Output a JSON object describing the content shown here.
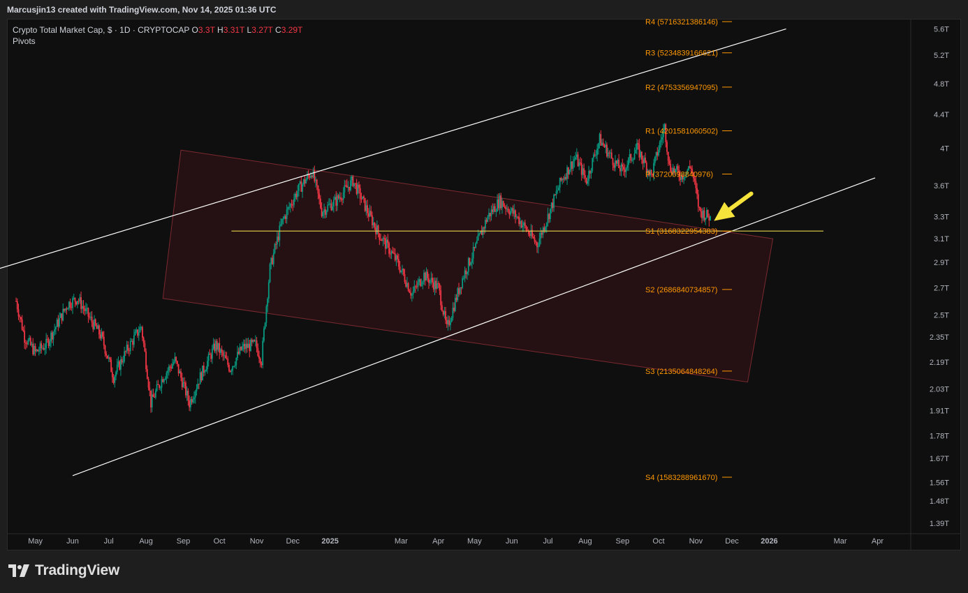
{
  "header": {
    "title": "Marcusjin13 created with TradingView.com, Nov 14, 2025 01:36 UTC"
  },
  "legend": {
    "symbol": "Crypto Total Market Cap, $ · 1D · CRYPTOCAP",
    "o_label": "O",
    "o_value": "3.3T",
    "h_label": "H",
    "h_value": "3.31T",
    "l_label": "L",
    "l_value": "3.27T",
    "c_label": "C",
    "c_value": "3.29T",
    "indicator": "Pivots"
  },
  "footer": {
    "brand": "TradingView"
  },
  "colors": {
    "up": "#089981",
    "down": "#f23645",
    "pivot": "#ff9800",
    "channel": "#ffffff",
    "support": "#e6d44a",
    "box_fill": "#2a1214",
    "box_stroke": "#7a2a30",
    "arrow": "#f5e33c"
  },
  "chart_data": {
    "type": "candlestick",
    "y_scale": "log",
    "ylim": [
      1.35,
      5.75
    ],
    "y_ticks": [
      "5.6T",
      "5.2T",
      "4.8T",
      "4.4T",
      "4T",
      "3.6T",
      "3.3T",
      "3.1T",
      "2.9T",
      "2.7T",
      "2.5T",
      "2.35T",
      "2.19T",
      "2.03T",
      "1.91T",
      "1.78T",
      "1.67T",
      "1.56T",
      "1.48T",
      "1.39T"
    ],
    "y_tick_values": [
      5.6,
      5.2,
      4.8,
      4.4,
      4.0,
      3.6,
      3.3,
      3.1,
      2.9,
      2.7,
      2.5,
      2.35,
      2.19,
      2.03,
      1.91,
      1.78,
      1.67,
      1.56,
      1.48,
      1.39
    ],
    "x_ticks": [
      "May",
      "Jun",
      "Jul",
      "Aug",
      "Sep",
      "Oct",
      "Nov",
      "Dec",
      "2025",
      "Mar",
      "Apr",
      "May",
      "Jun",
      "Jul",
      "Aug",
      "Sep",
      "Oct",
      "Nov",
      "Dec",
      "2026",
      "Mar",
      "Apr"
    ],
    "x_tick_dates": [
      "2024-05-01",
      "2024-06-01",
      "2024-07-01",
      "2024-08-01",
      "2024-09-01",
      "2024-10-01",
      "2024-11-01",
      "2024-12-01",
      "2025-01-01",
      "2025-03-01",
      "2025-04-01",
      "2025-05-01",
      "2025-06-01",
      "2025-07-01",
      "2025-08-01",
      "2025-09-01",
      "2025-10-01",
      "2025-11-01",
      "2025-12-01",
      "2026-01-01",
      "2026-03-01",
      "2026-04-01"
    ],
    "price_path": [
      [
        "2024-04-15",
        2.6
      ],
      [
        "2024-04-22",
        2.35
      ],
      [
        "2024-05-01",
        2.25
      ],
      [
        "2024-05-10",
        2.3
      ],
      [
        "2024-05-20",
        2.45
      ],
      [
        "2024-05-28",
        2.58
      ],
      [
        "2024-06-05",
        2.62
      ],
      [
        "2024-06-15",
        2.48
      ],
      [
        "2024-06-25",
        2.35
      ],
      [
        "2024-07-05",
        2.1
      ],
      [
        "2024-07-15",
        2.25
      ],
      [
        "2024-07-28",
        2.42
      ],
      [
        "2024-08-05",
        1.95
      ],
      [
        "2024-08-15",
        2.1
      ],
      [
        "2024-08-25",
        2.2
      ],
      [
        "2024-09-06",
        1.95
      ],
      [
        "2024-09-15",
        2.1
      ],
      [
        "2024-09-28",
        2.3
      ],
      [
        "2024-10-10",
        2.15
      ],
      [
        "2024-10-20",
        2.28
      ],
      [
        "2024-10-31",
        2.3
      ],
      [
        "2024-11-05",
        2.2
      ],
      [
        "2024-11-12",
        2.85
      ],
      [
        "2024-11-22",
        3.25
      ],
      [
        "2024-12-05",
        3.55
      ],
      [
        "2024-12-17",
        3.75
      ],
      [
        "2024-12-25",
        3.35
      ],
      [
        "2025-01-06",
        3.45
      ],
      [
        "2025-01-20",
        3.65
      ],
      [
        "2025-02-01",
        3.35
      ],
      [
        "2025-02-10",
        3.15
      ],
      [
        "2025-02-26",
        2.9
      ],
      [
        "2025-03-10",
        2.65
      ],
      [
        "2025-03-20",
        2.8
      ],
      [
        "2025-04-01",
        2.7
      ],
      [
        "2025-04-08",
        2.4
      ],
      [
        "2025-04-22",
        2.8
      ],
      [
        "2025-05-01",
        3.0
      ],
      [
        "2025-05-12",
        3.3
      ],
      [
        "2025-05-22",
        3.45
      ],
      [
        "2025-06-05",
        3.3
      ],
      [
        "2025-06-22",
        3.05
      ],
      [
        "2025-07-01",
        3.3
      ],
      [
        "2025-07-12",
        3.65
      ],
      [
        "2025-07-24",
        3.9
      ],
      [
        "2025-08-02",
        3.65
      ],
      [
        "2025-08-13",
        4.1
      ],
      [
        "2025-08-25",
        3.85
      ],
      [
        "2025-09-01",
        3.75
      ],
      [
        "2025-09-13",
        4.0
      ],
      [
        "2025-09-25",
        3.7
      ],
      [
        "2025-10-06",
        4.25
      ],
      [
        "2025-10-10",
        3.8
      ],
      [
        "2025-10-20",
        3.7
      ],
      [
        "2025-10-28",
        3.8
      ],
      [
        "2025-11-04",
        3.35
      ],
      [
        "2025-11-13",
        3.29
      ]
    ],
    "pivots": [
      {
        "label": "R4 (5716321386146)",
        "value": 5.716
      },
      {
        "label": "R3 (5234839166621)",
        "value": 5.235
      },
      {
        "label": "R2 (4753356947095)",
        "value": 4.753
      },
      {
        "label": "R1 (4201581060502)",
        "value": 4.202
      },
      {
        "label": "P (3720098840976)",
        "value": 3.72
      },
      {
        "label": "S1 (3168322954383)",
        "value": 3.168
      },
      {
        "label": "S2 (2686840734857)",
        "value": 2.687
      },
      {
        "label": "S3 (2135064848264)",
        "value": 2.135
      },
      {
        "label": "S4 (1583288961670)",
        "value": 1.583
      }
    ],
    "pivot_start": "2025-09-20",
    "pivot_end": "2025-12-01",
    "support_line": {
      "start": "2024-10-11",
      "end": "2026-02-15",
      "value": 3.168
    },
    "channel_upper": [
      [
        "2024-04-01",
        2.85
      ],
      [
        "2026-01-15",
        5.6
      ]
    ],
    "channel_lower": [
      [
        "2024-06-01",
        1.59
      ],
      [
        "2026-03-30",
        3.68
      ]
    ],
    "box": [
      [
        "2024-08-30",
        3.98
      ],
      [
        "2026-01-04",
        3.1
      ],
      [
        "2025-12-14",
        2.07
      ],
      [
        "2024-08-15",
        2.62
      ]
    ],
    "arrow": {
      "from": [
        "2025-12-17",
        3.52
      ],
      "to": [
        "2025-11-16",
        3.26
      ]
    }
  }
}
